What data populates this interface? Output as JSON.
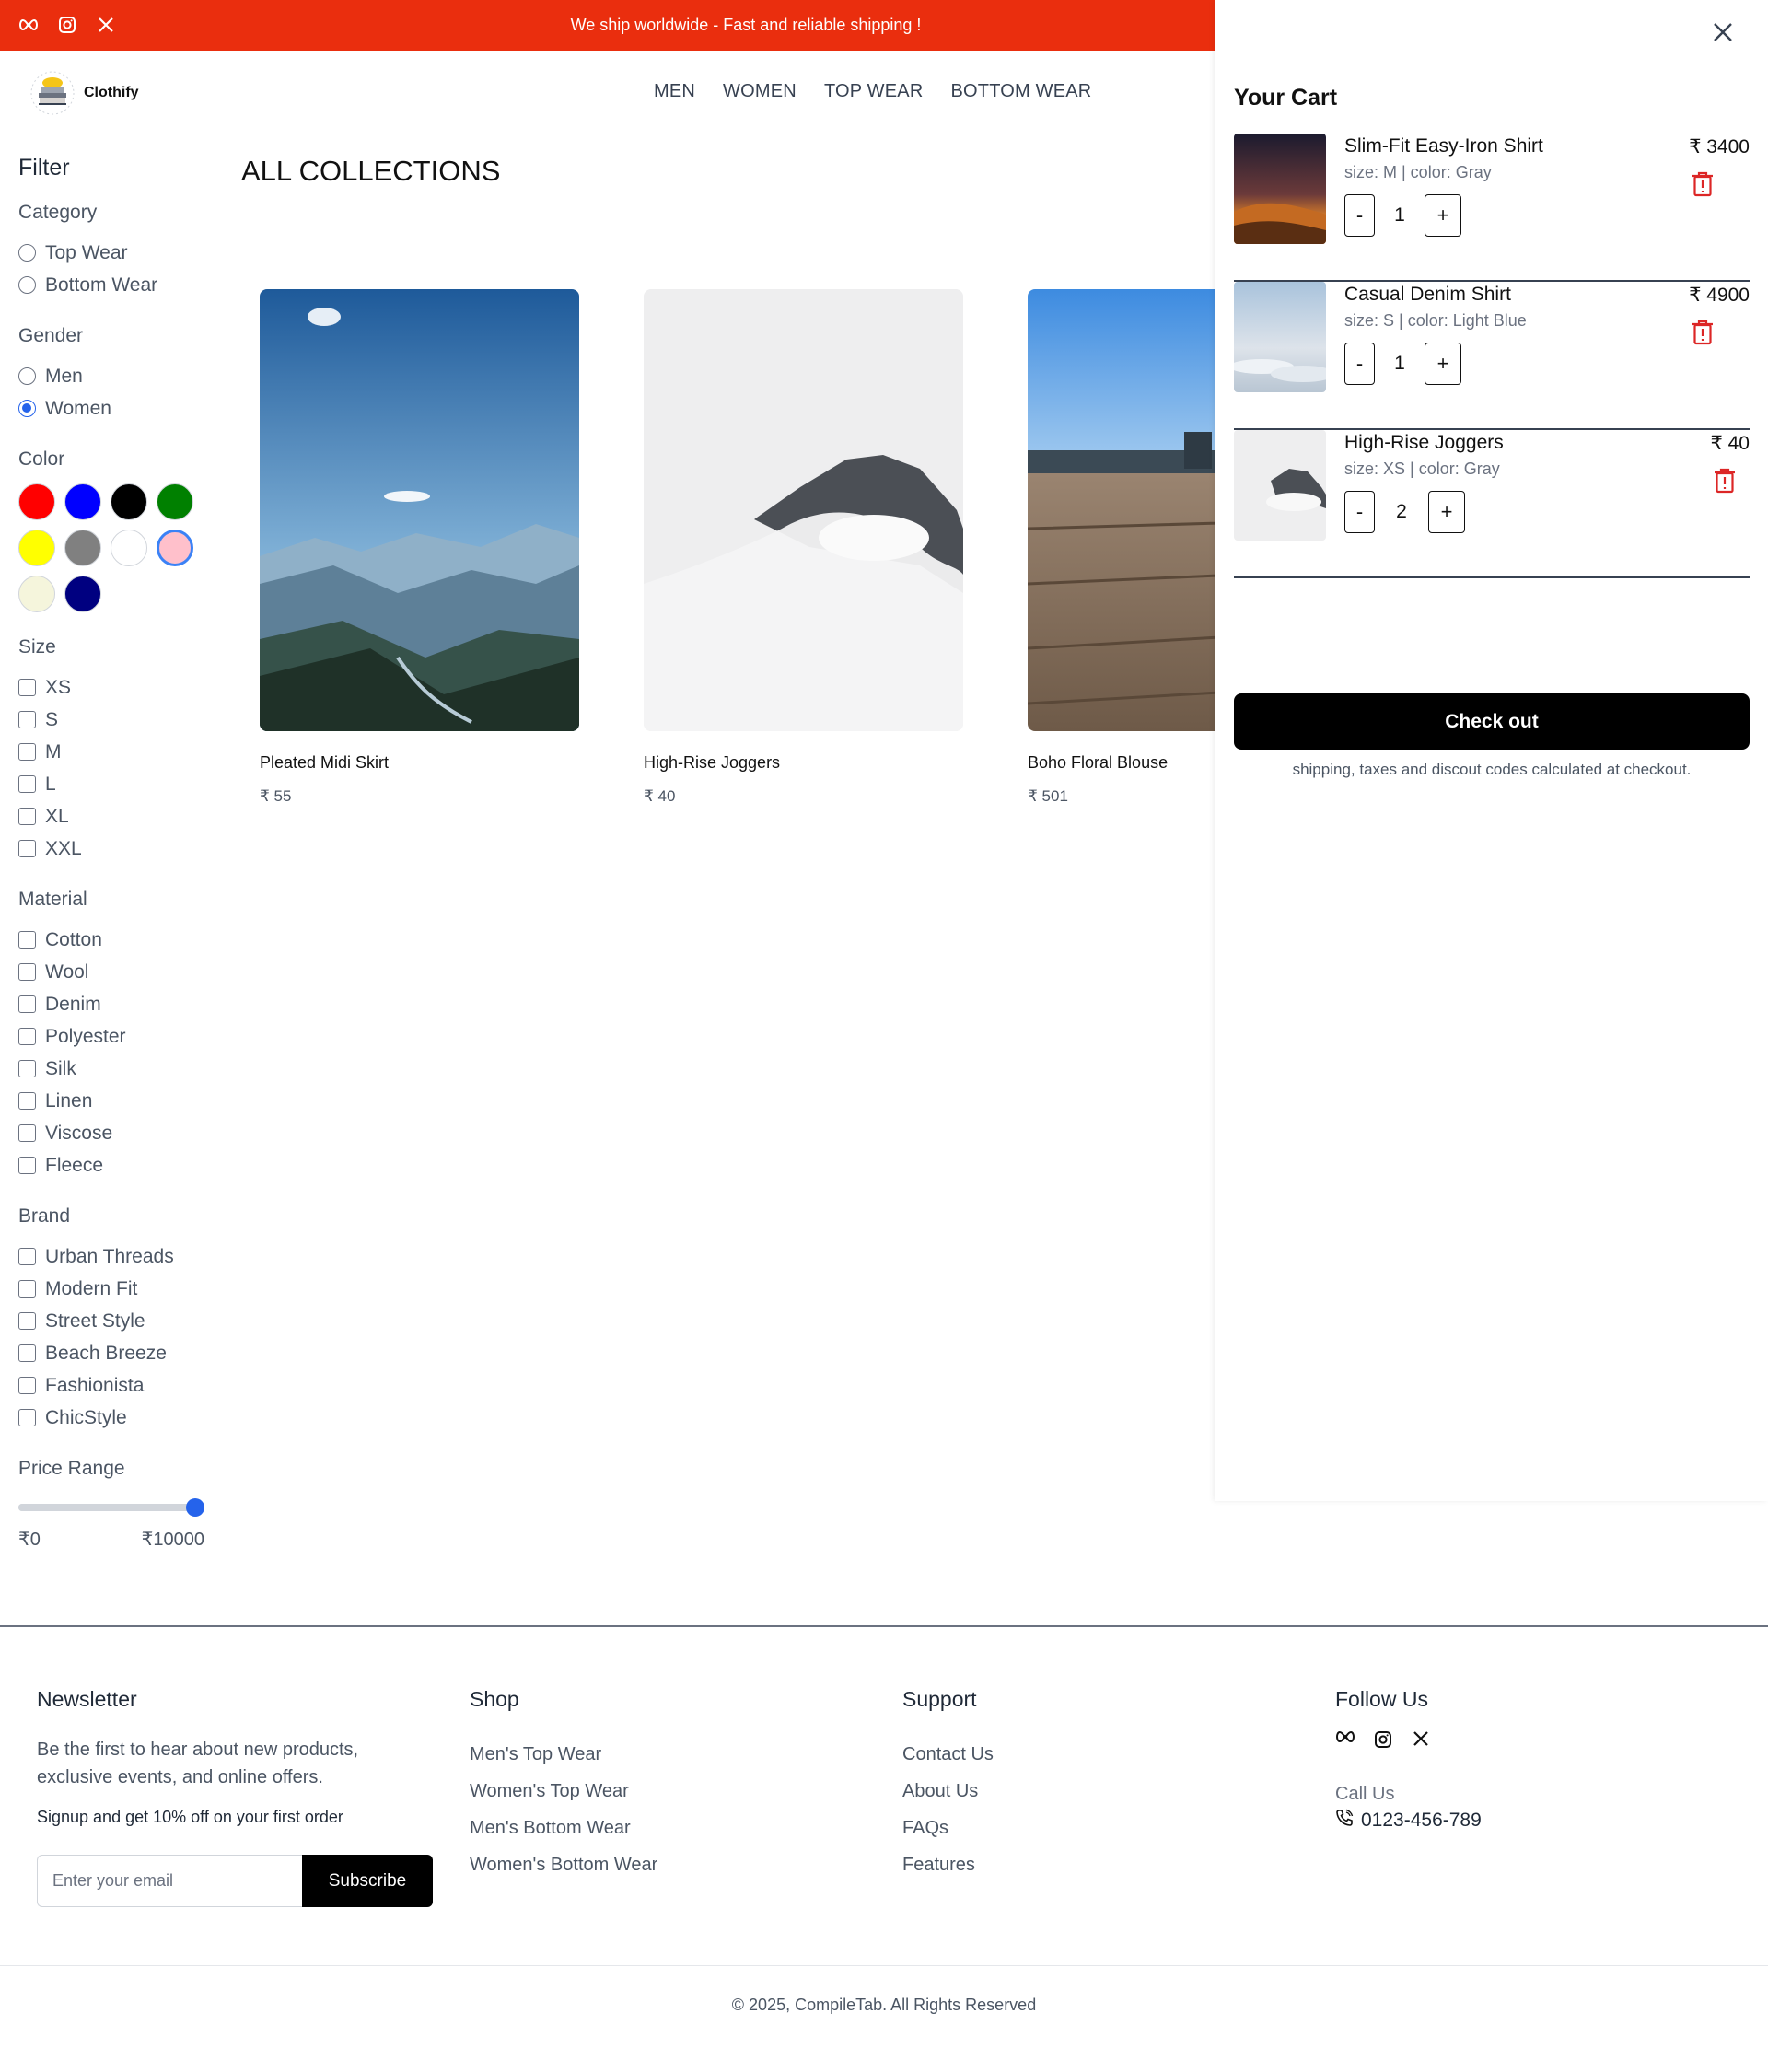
{
  "topbar": {
    "message": "We ship worldwide - Fast and reliable shipping !",
    "bg_color": "#ea2e0e",
    "social_icons": [
      "meta-icon",
      "instagram-icon",
      "x-icon"
    ]
  },
  "header": {
    "logo_text": "Clothify",
    "nav": [
      "MEN",
      "WOMEN",
      "TOP WEAR",
      "BOTTOM WEAR"
    ]
  },
  "filter": {
    "title": "Filter",
    "category": {
      "title": "Category",
      "options": [
        "Top Wear",
        "Bottom Wear"
      ],
      "selected": null
    },
    "gender": {
      "title": "Gender",
      "options": [
        "Men",
        "Women"
      ],
      "selected": "Women"
    },
    "color": {
      "title": "Color",
      "swatches": [
        "#ff0000",
        "#0000ff",
        "#000000",
        "#008000",
        "#ffff00",
        "#808080",
        "#ffffff",
        "#ffc0cb",
        "#f5f5dc",
        "#000080"
      ],
      "selected": "#ffc0cb"
    },
    "size": {
      "title": "Size",
      "options": [
        "XS",
        "S",
        "M",
        "L",
        "XL",
        "XXL"
      ]
    },
    "material": {
      "title": "Material",
      "options": [
        "Cotton",
        "Wool",
        "Denim",
        "Polyester",
        "Silk",
        "Linen",
        "Viscose",
        "Fleece"
      ]
    },
    "brand": {
      "title": "Brand",
      "options": [
        "Urban Threads",
        "Modern Fit",
        "Street Style",
        "Beach Breeze",
        "Fashionista",
        "ChicStyle"
      ]
    },
    "price_range": {
      "title": "Price Range",
      "min_label": "₹0",
      "max_label": "₹10000",
      "value_fraction": 1.0
    }
  },
  "collection": {
    "title": "ALL COLLECTIONS",
    "products": [
      {
        "name": "Pleated Midi Skirt",
        "price": "₹ 55",
        "image": "mountain-valley-photo"
      },
      {
        "name": "High-Rise Joggers",
        "price": "₹ 40",
        "image": "misty-peak-photo"
      },
      {
        "name": "Boho Floral Blouse",
        "price": "₹ 501",
        "image": "wooden-dock-photo"
      }
    ]
  },
  "cart": {
    "title": "Your Cart",
    "items": [
      {
        "name": "Slim-Fit Easy-Iron Shirt",
        "meta": "size: M | color: Gray",
        "qty": "1",
        "price": "₹ 3400",
        "image": "desert-sunset-photo"
      },
      {
        "name": "Casual Denim Shirt",
        "meta": "size: S | color: Light Blue",
        "qty": "1",
        "price": "₹ 4900",
        "image": "sky-clouds-photo"
      },
      {
        "name": "High-Rise Joggers",
        "meta": "size: XS | color: Gray",
        "qty": "2",
        "price": "₹ 40",
        "image": "misty-peak-photo"
      }
    ],
    "minus_label": "-",
    "plus_label": "+",
    "checkout_label": "Check out",
    "note": "shipping, taxes and discout codes calculated at checkout."
  },
  "footer": {
    "newsletter": {
      "title": "Newsletter",
      "desc": "Be the first to hear about new products, exclusive events, and online offers.",
      "promo": "Signup and get 10% off on your first order",
      "placeholder": "Enter your email",
      "button": "Subscribe"
    },
    "shop": {
      "title": "Shop",
      "links": [
        "Men's Top Wear",
        "Women's Top Wear",
        "Men's Bottom Wear",
        "Women's Bottom Wear"
      ]
    },
    "support": {
      "title": "Support",
      "links": [
        "Contact Us",
        "About Us",
        "FAQs",
        "Features"
      ]
    },
    "follow": {
      "title": "Follow Us",
      "call_label": "Call Us",
      "phone": "0123-456-789"
    },
    "copyright": "© 2025, CompileTab. All Rights Reserved"
  }
}
